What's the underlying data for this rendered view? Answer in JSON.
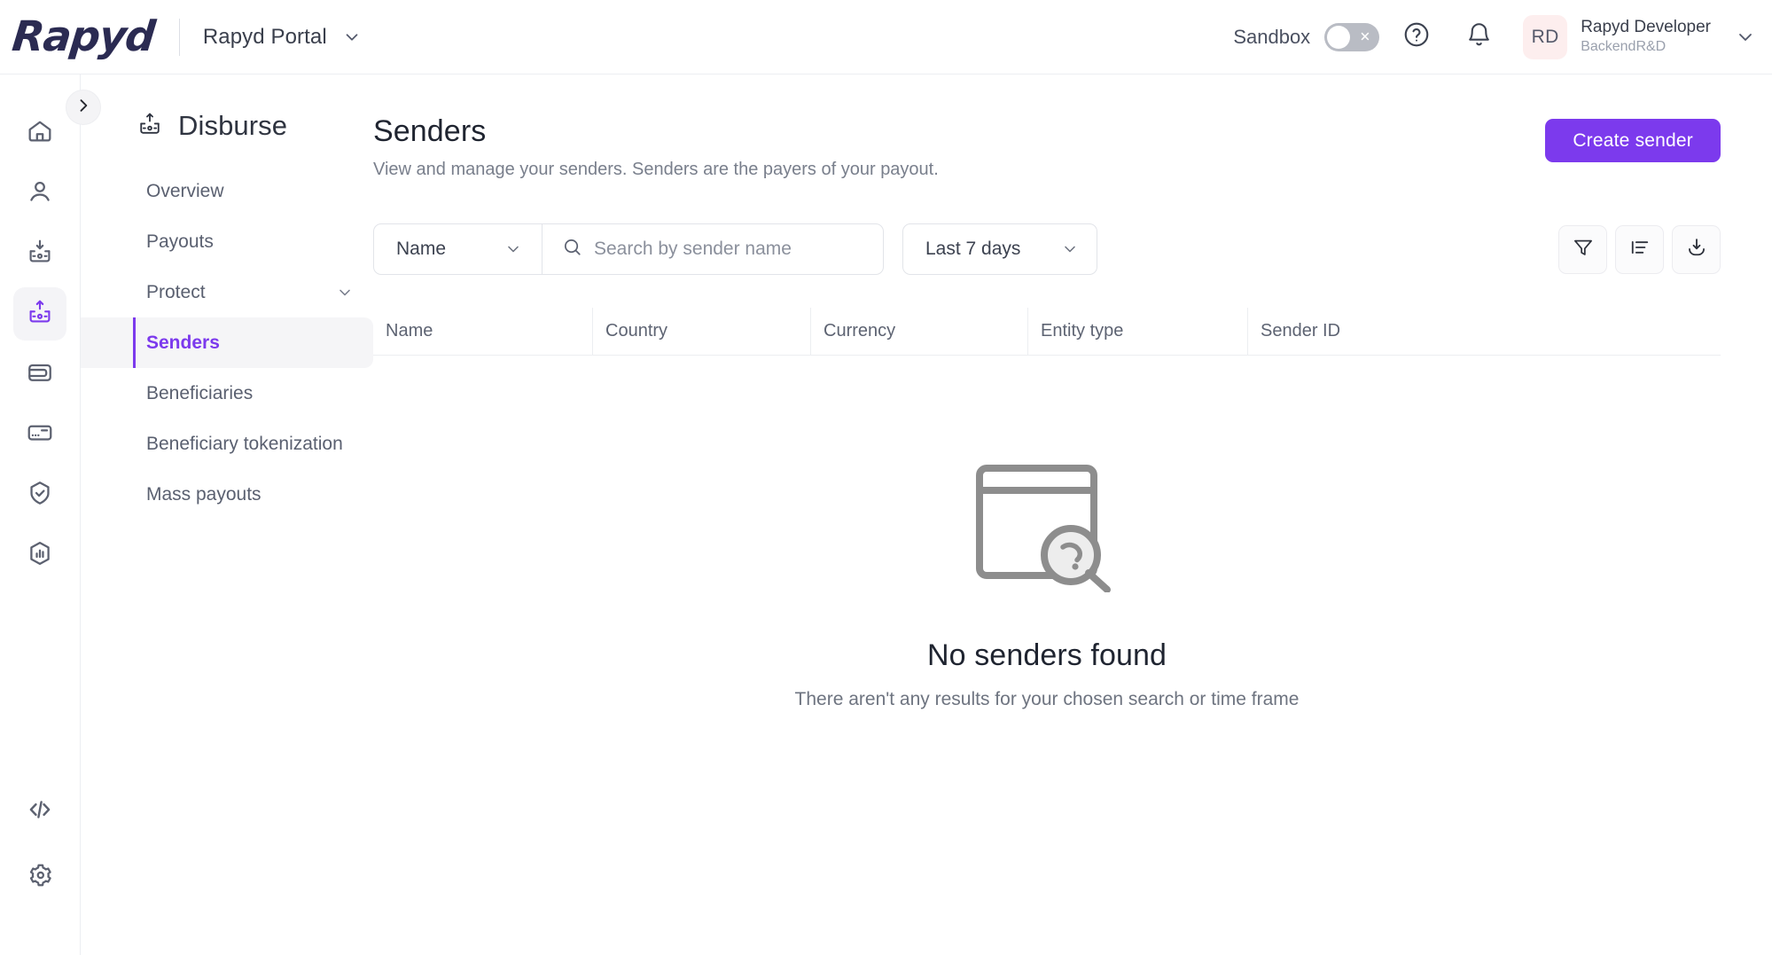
{
  "topbar": {
    "logo_text": "Rapyd",
    "portal_name": "Rapyd Portal",
    "sandbox_label": "Sandbox",
    "sandbox_state": "off",
    "help_icon": "question-circle-icon",
    "notifications_icon": "bell-icon",
    "avatar_initials": "RD",
    "user_name": "Rapyd Developer",
    "user_org": "BackendR&D"
  },
  "rail": {
    "items": [
      {
        "icon": "home-icon",
        "name": "home",
        "active": false
      },
      {
        "icon": "user-icon",
        "name": "customers",
        "active": false
      },
      {
        "icon": "collect-inbox-icon",
        "name": "collect",
        "active": false
      },
      {
        "icon": "disburse-outbox-icon",
        "name": "disburse",
        "active": true
      },
      {
        "icon": "wallet-icon",
        "name": "wallets",
        "active": false
      },
      {
        "icon": "card-icon",
        "name": "issuing",
        "active": false
      },
      {
        "icon": "shield-check-icon",
        "name": "protect",
        "active": false
      },
      {
        "icon": "chart-circle-icon",
        "name": "reports",
        "active": false
      }
    ],
    "bottom_items": [
      {
        "icon": "code-icon",
        "name": "developers"
      },
      {
        "icon": "gear-icon",
        "name": "settings"
      }
    ],
    "collapse_icon": "chevron-right-icon"
  },
  "section": {
    "icon": "disburse-outbox-icon",
    "title": "Disburse",
    "items": [
      {
        "label": "Overview",
        "active": false,
        "expandable": false
      },
      {
        "label": "Payouts",
        "active": false,
        "expandable": false
      },
      {
        "label": "Protect",
        "active": false,
        "expandable": true
      },
      {
        "label": "Senders",
        "active": true,
        "expandable": false
      },
      {
        "label": "Beneficiaries",
        "active": false,
        "expandable": false
      },
      {
        "label": "Beneficiary tokenization",
        "active": false,
        "expandable": false
      },
      {
        "label": "Mass payouts",
        "active": false,
        "expandable": false
      }
    ]
  },
  "page": {
    "title": "Senders",
    "subtitle": "View and manage your senders. Senders are the payers of your payout.",
    "create_button": "Create sender"
  },
  "filters": {
    "field_select_value": "Name",
    "search_placeholder": "Search by sender name",
    "search_value": "",
    "search_icon": "search-icon",
    "date_range_value": "Last 7 days",
    "tools": [
      {
        "icon": "filter-funnel-icon",
        "name": "filter"
      },
      {
        "icon": "sort-lines-icon",
        "name": "sort"
      },
      {
        "icon": "download-icon",
        "name": "export"
      }
    ]
  },
  "table": {
    "columns": [
      "Name",
      "Country",
      "Currency",
      "Entity type",
      "Sender ID"
    ],
    "rows": []
  },
  "empty_state": {
    "illustration": "window-with-magnifier-icon",
    "title": "No senders found",
    "subtitle": "There aren't any results for your chosen search or time frame"
  },
  "colors": {
    "accent": "#7c3aed",
    "logo": "#2b2b52",
    "avatar_bg": "#fdeeee",
    "border": "#eceef2",
    "muted_text": "#797f8c"
  }
}
